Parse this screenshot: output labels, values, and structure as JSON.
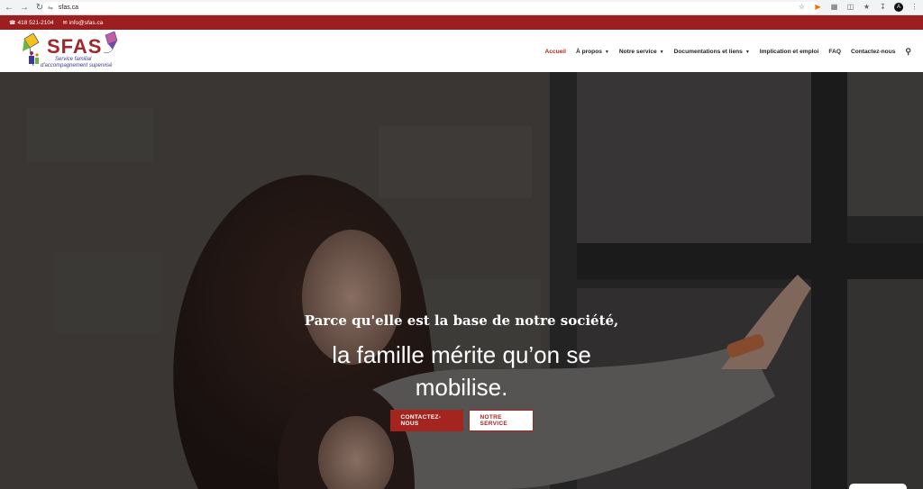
{
  "browser": {
    "url": "sfas.ca",
    "avatar_letter": "A"
  },
  "top_bar": {
    "phone": "418 521-2104",
    "email": "info@sfas.ca",
    "bg_color": "#9c1e1e"
  },
  "logo": {
    "word": "SFAS",
    "line1": "Service familial",
    "line2": "d'accompagnement supervisé"
  },
  "nav": {
    "items": [
      {
        "label": "Accueil",
        "active": true
      },
      {
        "label": "À propos",
        "dropdown": true
      },
      {
        "label": "Notre service",
        "dropdown": true
      },
      {
        "label": "Documentations et liens",
        "dropdown": true
      },
      {
        "label": "Implication et emploi"
      },
      {
        "label": "FAQ"
      },
      {
        "label": "Contactez-nous"
      }
    ],
    "accent": "#b3261e"
  },
  "hero": {
    "kicker": "Parce qu'elle est la base de notre société,",
    "title_line1": "la famille mérite qu’on se",
    "title_line2": "mobilise.",
    "primary_button": "CONTACTEZ-NOUS",
    "secondary_button": "NOTRE SERVICE"
  }
}
